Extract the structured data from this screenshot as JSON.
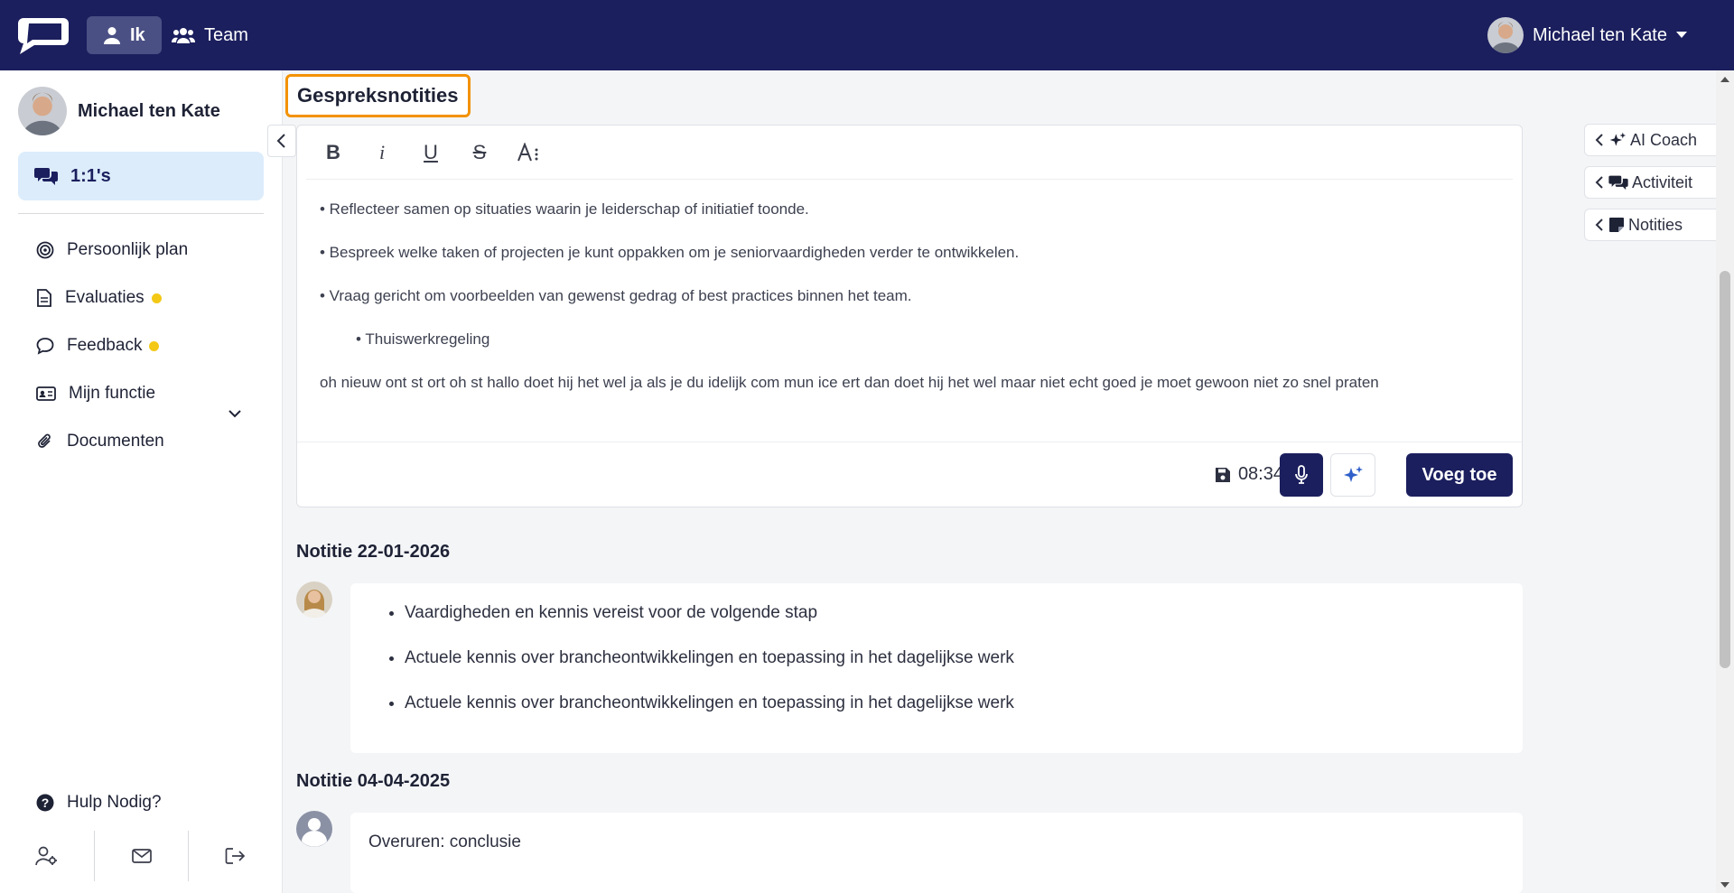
{
  "topbar": {
    "tabs": [
      {
        "label": "Ik",
        "icon": "user-icon",
        "active": true
      },
      {
        "label": "Team",
        "icon": "users-icon",
        "active": false
      }
    ],
    "user_name": "Michael ten Kate"
  },
  "sidebar": {
    "user_name": "Michael ten Kate",
    "active_item": {
      "label": "1:1's",
      "icon": "comments-icon"
    },
    "items": [
      {
        "label": "Persoonlijk plan",
        "icon": "target-icon",
        "badge": false
      },
      {
        "label": "Evaluaties",
        "icon": "document-icon",
        "badge": true
      },
      {
        "label": "Feedback",
        "icon": "speech-bubble-icon",
        "badge": true,
        "expandable": true
      },
      {
        "label": "Mijn functie",
        "icon": "id-card-icon",
        "badge": false
      },
      {
        "label": "Documenten",
        "icon": "paperclip-icon",
        "badge": false
      }
    ],
    "help_label": "Hulp Nodig?",
    "badge_color": "#f3c816"
  },
  "main": {
    "title": "Gespreksnotities",
    "editor": {
      "lines": [
        "• Reflecteer samen op situaties  waarin je leiderschap of initiatief  toonde.",
        "• Bespreek  welke taken of projecten je  kunt oppakken om je seniorvaardigheden  verder te ontwikkelen.",
        "• Vraag gericht om voorbeelden  van gewenst gedrag of best  practices binnen het team."
      ],
      "sub_item": "Thuiswerkregeling",
      "free_text": "oh nieuw ont st ort oh st hallo doet hij het wel ja als je du idelijk com mun ice ert dan doet hij het wel maar niet echt goed je moet gewoon niet zo snel praten",
      "timer": "08:34",
      "add_label": "Voeg toe"
    },
    "notes": [
      {
        "title": "Notitie 22-01-2026",
        "items": [
          "Vaardigheden en kennis vereist voor de volgende stap",
          "Actuele kennis over brancheontwikkelingen en toepassing in het dagelijkse werk",
          "Actuele kennis over brancheontwikkelingen en toepassing in het dagelijkse werk"
        ]
      },
      {
        "title": "Notitie 04-04-2025",
        "text": "Overuren: conclusie"
      }
    ]
  },
  "right_panel": {
    "tabs": [
      {
        "label": "AI Coach",
        "icon": "sparkles-icon"
      },
      {
        "label": "Activiteit",
        "icon": "comments-icon"
      },
      {
        "label": "Notities",
        "icon": "sticky-note-icon"
      }
    ]
  },
  "colors": {
    "brand": "#1b1f5e",
    "highlight": "#f39200",
    "active_bg": "#dcecfb"
  }
}
